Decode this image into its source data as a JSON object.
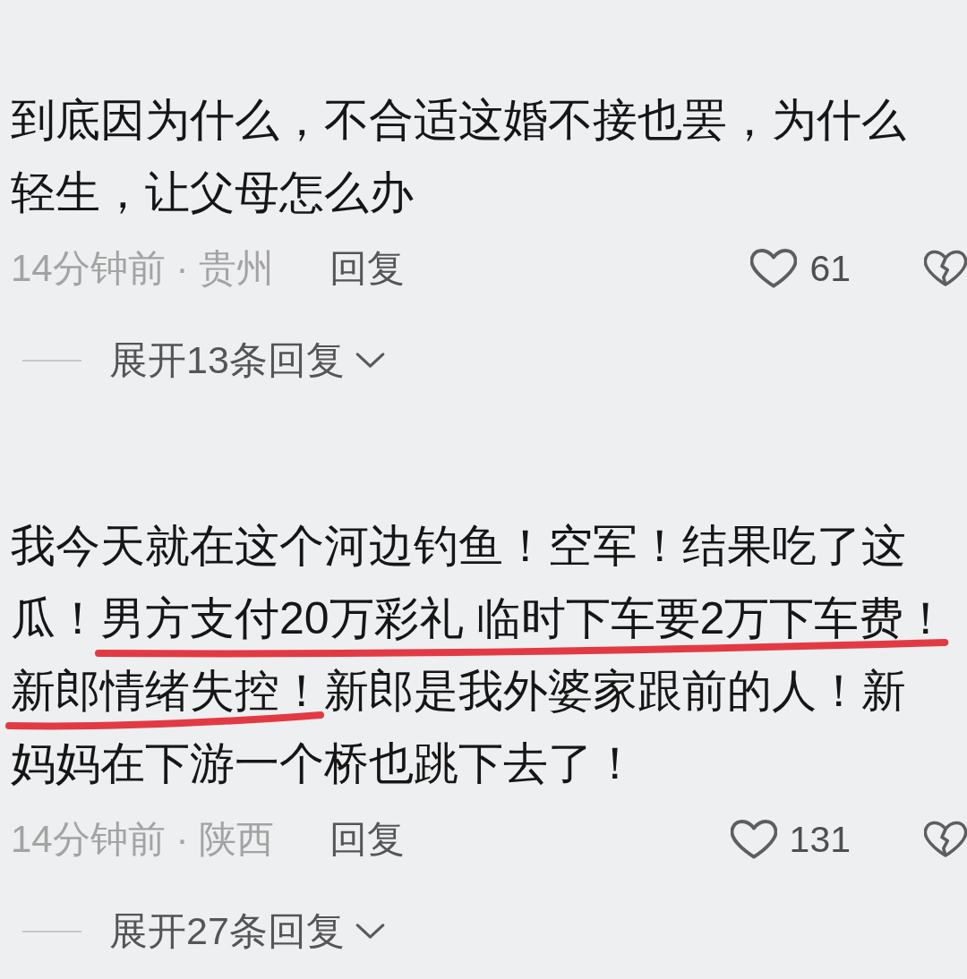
{
  "comments": [
    {
      "lines": [
        [
          {
            "text": "到底因为什么，不合适这婚不接也罢，为什么",
            "underlined": false
          }
        ],
        [
          {
            "text": "轻生，让父母怎么办",
            "underlined": false
          }
        ]
      ],
      "posted": "14分钟前 · 贵州",
      "reply": "回复",
      "liked": false,
      "likes": "61",
      "expand": "展开13条回复"
    },
    {
      "lines": [
        [
          {
            "text": "我今天就在这个河边钓鱼！空军！结果吃了这",
            "underlined": false
          }
        ],
        [
          {
            "text": "瓜！",
            "underlined": false
          },
          {
            "text": "男方支付20万彩礼 临时下车要2万下车费！",
            "underlined": true
          }
        ],
        [
          {
            "text": "新郎情绪失控！",
            "underlined": true
          },
          {
            "text": "新郎是我外婆家跟前的人！新",
            "underlined": false
          }
        ],
        [
          {
            "text": "妈妈在下游一个桥也跳下去了！",
            "underlined": false
          }
        ]
      ],
      "posted": "14分钟前 · 陕西",
      "reply": "回复",
      "liked": false,
      "likes": "131",
      "expand": "展开27条回复"
    }
  ]
}
